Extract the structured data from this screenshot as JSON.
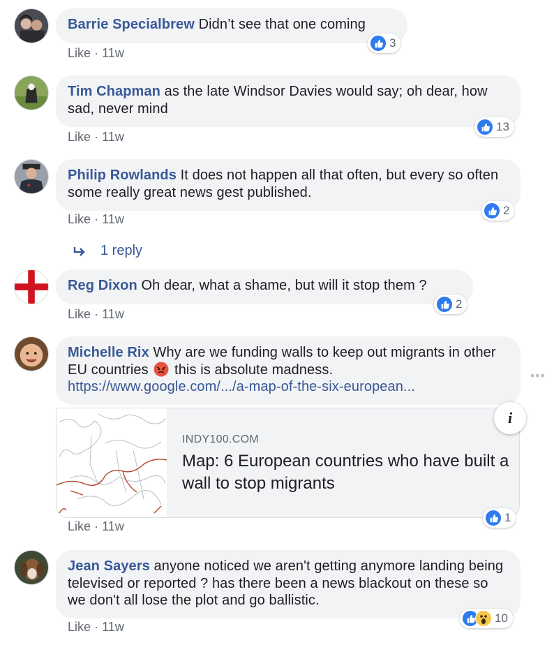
{
  "colors": {
    "author": "#385898",
    "bubble": "#f2f3f5",
    "meta": "#606770",
    "like_blue": "#2e7bf0"
  },
  "comments": [
    {
      "author": "Barrie Specialbrew",
      "text": "Didn’t see that one coming",
      "like": "Like",
      "sep": "·",
      "time": "11w",
      "reactions": [
        "thumb"
      ],
      "count": "3"
    },
    {
      "author": "Tim Chapman",
      "text": "as the late Windsor Davies would say; oh dear, how sad, never mind",
      "like": "Like",
      "sep": "·",
      "time": "11w",
      "reactions": [
        "thumb"
      ],
      "count": "13"
    },
    {
      "author": "Philip Rowlands",
      "text": "It does not happen all that often, but every so often some really great news gest published.",
      "like": "Like",
      "sep": "·",
      "time": "11w",
      "reactions": [
        "thumb"
      ],
      "count": "2"
    },
    {
      "author": "Reg Dixon",
      "text": "Oh dear, what a shame, but will it stop them ?",
      "like": "Like",
      "sep": "·",
      "time": "11w",
      "reactions": [
        "thumb"
      ],
      "count": "2"
    },
    {
      "author": "Michelle Rix",
      "text": "Why are we funding walls to keep out migrants in other EU countries",
      "emoji": "angry-face-icon",
      "text2": "this is absolute madness.",
      "link": "https://www.google.com/.../a-map-of-the-six-european...",
      "like": "Like",
      "sep": "·",
      "time": "11w",
      "reactions": [
        "thumb"
      ],
      "count": "1"
    },
    {
      "author": "Jean Sayers",
      "text": "anyone noticed we aren't getting anymore landing being televised or reported ? has there been a news blackout on these so we don't all lose the plot and go ballistic.",
      "like": "Like",
      "sep": "·",
      "time": "11w",
      "reactions": [
        "thumb",
        "wow"
      ],
      "count": "10"
    }
  ],
  "reply_link": {
    "label": "1 reply",
    "icon": "reply-arrow-icon"
  },
  "link_card": {
    "domain": "INDY100.COM",
    "title": "Map: 6 European countries who have built a wall to stop migrants",
    "info_icon": "i"
  },
  "more_icon": "•••"
}
